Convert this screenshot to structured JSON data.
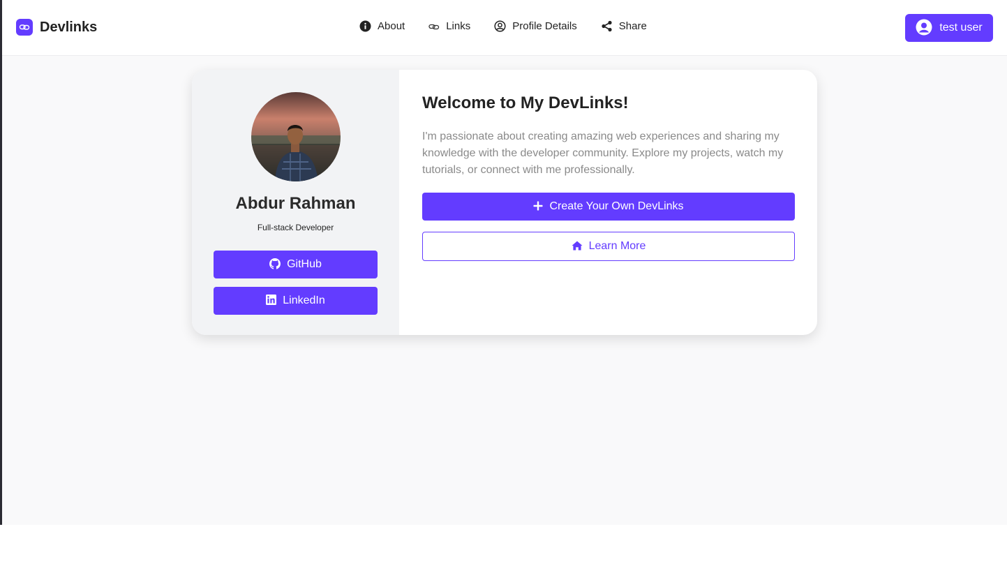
{
  "brand": {
    "name": "Devlinks",
    "logo_icon": "link-icon",
    "color": "#633cff"
  },
  "nav": {
    "items": [
      {
        "label": "About",
        "icon": "info-icon"
      },
      {
        "label": "Links",
        "icon": "link-icon"
      },
      {
        "label": "Profile Details",
        "icon": "user-circle-icon"
      },
      {
        "label": "Share",
        "icon": "share-icon"
      }
    ]
  },
  "user": {
    "label": "test user",
    "icon": "user-circle-icon"
  },
  "profile": {
    "name": "Abdur Rahman",
    "title": "Full-stack Developer",
    "social": [
      {
        "label": "GitHub",
        "icon": "github-icon"
      },
      {
        "label": "LinkedIn",
        "icon": "linkedin-icon"
      }
    ]
  },
  "main": {
    "heading": "Welcome to My DevLinks!",
    "description": "I'm passionate about creating amazing web experiences and sharing my knowledge with the developer community. Explore my projects, watch my tutorials, or connect with me professionally.",
    "primary_button": {
      "label": "Create Your Own DevLinks",
      "icon": "plus-icon"
    },
    "secondary_button": {
      "label": "Learn More",
      "icon": "home-icon"
    }
  },
  "colors": {
    "accent": "#633cff",
    "page_background": "#f9f9fa",
    "sidebar_background": "#f2f3f5",
    "muted_text": "#8a8a8a"
  }
}
